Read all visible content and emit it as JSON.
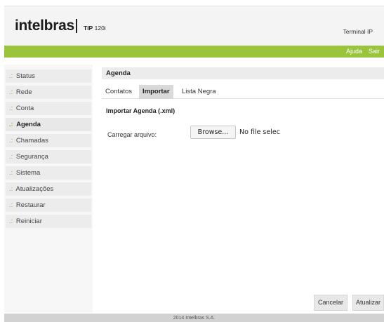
{
  "header": {
    "brand": "intelbras",
    "model_prefix": "TIP",
    "model_suffix": "120i",
    "device_label": "Terminal IP"
  },
  "topbar": {
    "help_label": "Ajuda",
    "logout_label": "Sair",
    "color": "#99c43b"
  },
  "sidebar": {
    "bullet": ".:",
    "active_index": 3,
    "items": [
      {
        "label": "Status"
      },
      {
        "label": "Rede"
      },
      {
        "label": "Conta"
      },
      {
        "label": "Agenda"
      },
      {
        "label": "Chamadas"
      },
      {
        "label": "Segurança"
      },
      {
        "label": "Sistema"
      },
      {
        "label": "Atualizações"
      },
      {
        "label": "Restaurar"
      },
      {
        "label": "Reiniciar"
      }
    ]
  },
  "main": {
    "section_title": "Agenda",
    "active_tab": 1,
    "tabs": [
      {
        "label": "Contatos"
      },
      {
        "label": "Importar"
      },
      {
        "label": "Lista Negra"
      }
    ],
    "subsection_title": "Importar Agenda (.xml)",
    "upload_label": "Carregar arquivo:",
    "browse_label": "Browse...",
    "file_status": "No file selected."
  },
  "actions": {
    "cancel_label": "Cancelar",
    "save_label": "Atualizar"
  },
  "footer": {
    "copyright": "2014 Intelbras S.A."
  }
}
